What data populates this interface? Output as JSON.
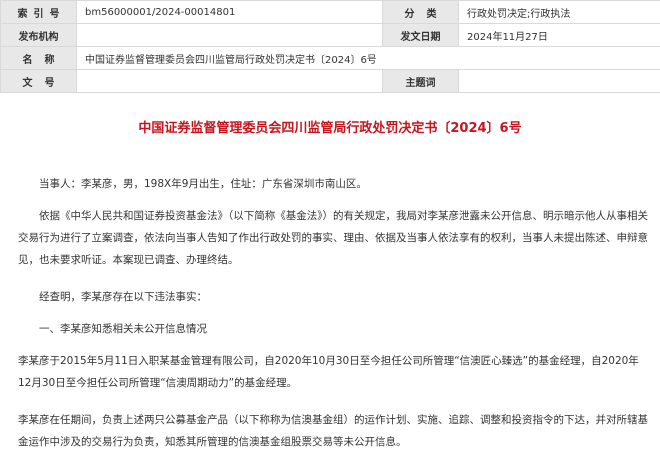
{
  "meta": {
    "index_label": "索引号",
    "index_value": "bm56000001/2024-00014801",
    "category_label": "分类",
    "category_value": "行政处罚决定;行政执法",
    "issuer_label": "发布机构",
    "issuer_value": "",
    "date_label": "发文日期",
    "date_value": "2024年11月27日",
    "name_label": "名称",
    "name_value": "中国证券监督管理委员会四川监管局行政处罚决定书〔2024〕6号",
    "docno_label": "文号",
    "docno_value": "",
    "keywords_label": "主题词",
    "keywords_value": ""
  },
  "document": {
    "title": "中国证券监督管理委员会四川监管局行政处罚决定书〔2024〕6号",
    "paragraphs": [
      "当事人：李某彦，男，198X年9月出生，住址：广东省深圳市南山区。",
      "依据《中华人民共和国证券投资基金法》（以下简称《基金法》）的有关规定，我局对李某彦泄露未公开信息、明示暗示他人从事相关交易行为进行了立案调查，依法向当事人告知了作出行政处罚的事实、理由、依据及当事人依法享有的权利，当事人未提出陈述、申辩意见，也未要求听证。本案现已调查、办理终结。",
      "经查明，李某彦存在以下违法事实：",
      "一、李某彦知悉相关未公开信息情况",
      "李某彦于2015年5月11日入职某基金管理有限公司，自2020年10月30日至今担任公司所管理“信澳匠心臻选”的基金经理，自2020年12月30日至今担任公司所管理“信澳周期动力”的基金经理。",
      "李某彦在任期间，负责上述两只公募基金产品（以下称称为信澳基金组）的运作计划、实施、追踪、调整和投资指令的下达，并对所辖基金运作中涉及的交易行为负责，知悉其所管理的信澳基金组股票交易等未公开信息。"
    ]
  }
}
